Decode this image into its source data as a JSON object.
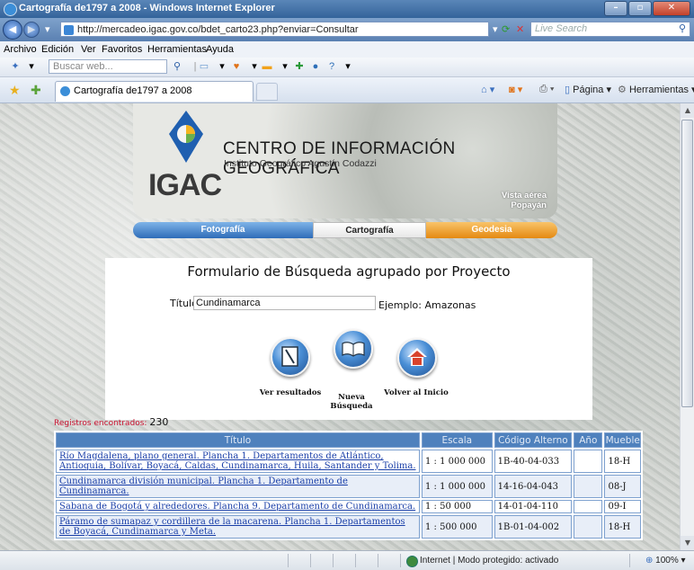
{
  "window": {
    "title": "Cartografía de1797 a 2008 - Windows Internet Explorer"
  },
  "address": {
    "url": "http://mercadeo.igac.gov.co/bdet_carto23.php?enviar=Consultar",
    "live_search_placeholder": "Live Search"
  },
  "menu": [
    "Archivo",
    "Edición",
    "Ver",
    "Favoritos",
    "Herramientas",
    "Ayuda"
  ],
  "toolbar": {
    "search_placeholder": "Buscar web..."
  },
  "tabs": {
    "active_label": "Cartografía de1797 a 2008"
  },
  "commandbar": {
    "page_label": "Página",
    "tools_label": "Herramientas"
  },
  "banner": {
    "heading": "CENTRO DE INFORMACIÓN GEOGRÁFICA",
    "subheading": "Instituto Geográfico Agustín Codazzi",
    "logo_text": "IGAC",
    "photo_caption_1": "Vista aérea",
    "photo_caption_2": "Popayán",
    "sections": [
      "Fotografía",
      "Cartografía",
      "Geodesia"
    ]
  },
  "form": {
    "title": "Formulario de Búsqueda agrupado por Proyecto",
    "field_label": "Título",
    "field_value": "Cundinamarca",
    "example_label": "Ejemplo: Amazonas",
    "buttons": {
      "ver": "Ver resultados",
      "nueva_1": "Nueva",
      "nueva_2": "Búsqueda",
      "volver": "Volver al Inicio"
    }
  },
  "results": {
    "count_label": "Registros encontrados:",
    "count": "230",
    "headers": [
      "Título",
      "Escala",
      "Código Alterno",
      "Año",
      "Mueble"
    ],
    "rows": [
      {
        "titulo": "Río Magdalena, plano general. Plancha 1. Departamentos de Atlántico, Antioquia, Bolívar, Boyacá, Caldas, Cundinamarca, Huila, Santander y Tolima.",
        "escala": "1 : 1 000 000",
        "codigo": "1B-40-04-033",
        "anio": "",
        "mueble": "18-H"
      },
      {
        "titulo": "Cundinamarca división municipal. Plancha 1. Departamento de Cundinamarca.",
        "escala": "1 : 1 000 000",
        "codigo": "14-16-04-043",
        "anio": "",
        "mueble": "08-J"
      },
      {
        "titulo": "Sabana de Bogotá y alrededores. Plancha 9. Departamento de Cundinamarca.",
        "escala": "1 : 50 000",
        "codigo": "14-01-04-110",
        "anio": "",
        "mueble": "09-I"
      },
      {
        "titulo": "Páramo de sumapaz y cordillera de la macarena. Plancha 1. Departamentos de Boyacá, Cundinamarca y Meta.",
        "escala": "1 : 500 000",
        "codigo": "1B-01-04-002",
        "anio": "",
        "mueble": "18-H"
      }
    ]
  },
  "status": {
    "zone": "Internet | Modo protegido: activado",
    "zoom": "100%"
  }
}
